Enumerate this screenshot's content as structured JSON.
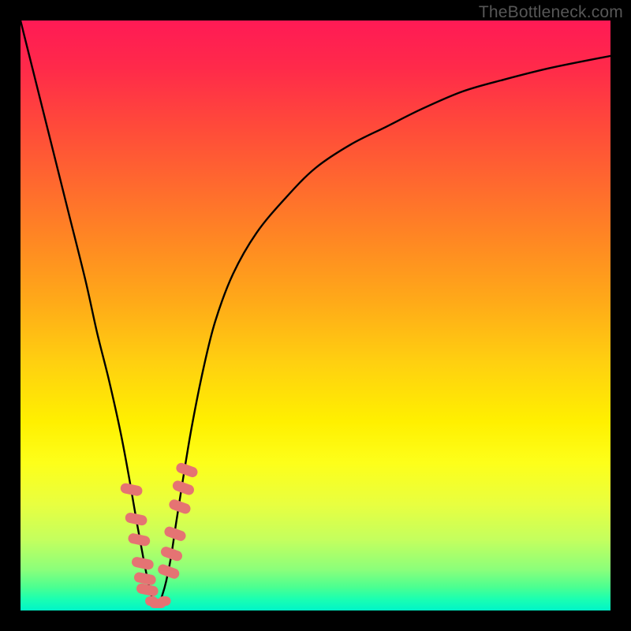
{
  "watermark": {
    "text": "TheBottleneck.com"
  },
  "colors": {
    "frame": "#000000",
    "curve": "#000000",
    "marker": "#e57373",
    "gradient_top": "#ff1a55",
    "gradient_bottom": "#00f5c8"
  },
  "chart_data": {
    "type": "line",
    "title": "",
    "xlabel": "",
    "ylabel": "",
    "xlim": [
      0,
      100
    ],
    "ylim": [
      0,
      100
    ],
    "grid": false,
    "x": [
      0,
      2,
      5,
      8,
      11,
      13,
      15,
      17,
      18.5,
      19.7,
      20.8,
      21.6,
      22.2,
      22.8,
      23.4,
      24,
      24.7,
      25.5,
      26.4,
      27.5,
      29,
      31,
      33,
      36,
      40,
      45,
      50,
      56,
      62,
      68,
      75,
      82,
      90,
      100
    ],
    "y": [
      100,
      92,
      80,
      68,
      56,
      47,
      39,
      30,
      22,
      15,
      9,
      5,
      2.5,
      1,
      1,
      2.5,
      5,
      9,
      15,
      22,
      31,
      41,
      49,
      57,
      64,
      70,
      75,
      79,
      82,
      85,
      88,
      90,
      92,
      94
    ],
    "markers": {
      "left_branch_x": [
        18.8,
        19.6,
        20.1,
        20.7,
        21.1,
        21.5
      ],
      "left_branch_y": [
        20.5,
        15.5,
        12.0,
        8.0,
        5.4,
        3.5
      ],
      "right_branch_x": [
        25.1,
        25.6,
        26.2,
        27.0,
        27.6,
        28.2
      ],
      "right_branch_y": [
        6.6,
        9.6,
        13.0,
        17.6,
        20.8,
        23.8
      ],
      "bottom_x": [
        22.2,
        22.9,
        23.6,
        24.4
      ],
      "bottom_y": [
        1.6,
        1.2,
        1.2,
        1.6
      ]
    }
  }
}
